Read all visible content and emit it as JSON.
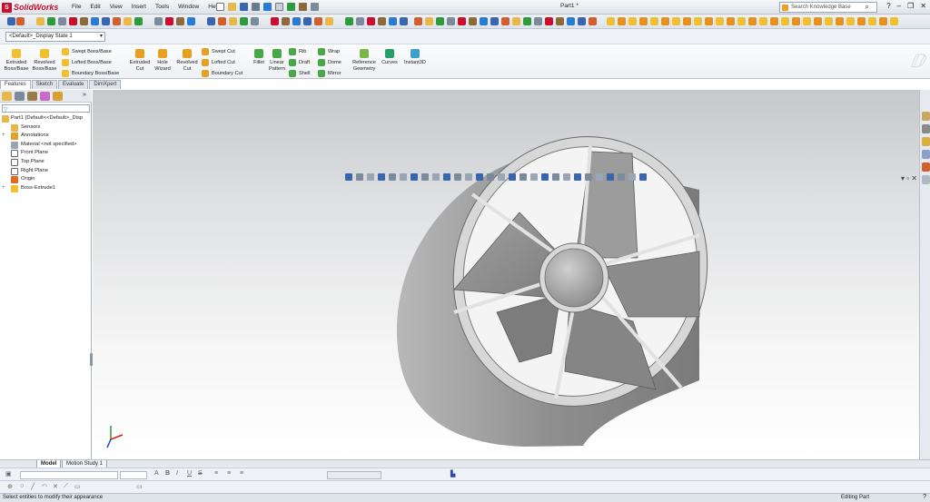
{
  "app": {
    "brand": "SolidWorks",
    "menu": [
      "File",
      "Edit",
      "View",
      "Insert",
      "Tools",
      "Window",
      "Help"
    ],
    "doc_title": "Part1 *",
    "search_placeholder": "Search Knowledge Base",
    "help_btn": "?"
  },
  "config": {
    "selected": "<Default>_Display State 1"
  },
  "commands": {
    "extruded_boss": "Extruded Boss/Base",
    "revolved_boss": "Revolved Boss/Base",
    "swept_boss": "Swept Boss/Base",
    "lofted_boss": "Lofted Boss/Base",
    "boundary_boss": "Boundary Boss/Base",
    "extruded_cut": "Extruded Cut",
    "hole_wizard": "Hole Wizard",
    "revolved_cut": "Revolved Cut",
    "swept_cut": "Swept Cut",
    "lofted_cut": "Lofted Cut",
    "boundary_cut": "Boundary Cut",
    "fillet": "Fillet",
    "linear_pattern": "Linear Pattern",
    "rib": "Rib",
    "draft": "Draft",
    "shell": "Shell",
    "wrap": "Wrap",
    "dome": "Dome",
    "mirror": "Mirror",
    "reference_geometry": "Reference Geometry",
    "curves": "Curves",
    "instant3d": "Instant3D"
  },
  "tabs": [
    "Features",
    "Sketch",
    "Evaluate",
    "DimXpert"
  ],
  "tree": {
    "root": "Part1  (Default<<Default>_Disp",
    "items": [
      "Sensors",
      "Annotations",
      "Material <not specified>",
      "Front Plane",
      "Top Plane",
      "Right Plane",
      "Origin",
      "Boss-Extrude1"
    ]
  },
  "bottom_tabs": [
    "Model",
    "Motion Study 1"
  ],
  "status": {
    "message": "Select entities to modify their appearance",
    "mode": "Editing Part"
  },
  "colors": {
    "brand_red": "#c8102e",
    "part_gray": "#9a9a9a"
  }
}
